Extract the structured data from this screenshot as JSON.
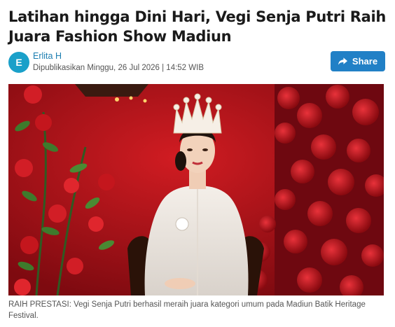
{
  "article": {
    "title": "Latihan hingga Dini Hari, Vegi Senja Putri Raih Juara Fashion Show Madiun",
    "author": {
      "initial": "E",
      "name": "Erlita H",
      "published": "Dipublikasikan Minggu, 26 Jul 2026 | 14:52 WIB"
    },
    "share": {
      "label": "Share",
      "icon": "share-arrow-icon"
    },
    "image": {
      "description_icon": "photo",
      "caption": "RAIH PRESTASI: Vegi Senja Putri berhasil meraih juara kategori umum pada Madiun Batik Heritage Festival."
    }
  },
  "colors": {
    "accent": "#2180c6",
    "avatar": "#1aa0c9",
    "author_link": "#1b7db0"
  }
}
